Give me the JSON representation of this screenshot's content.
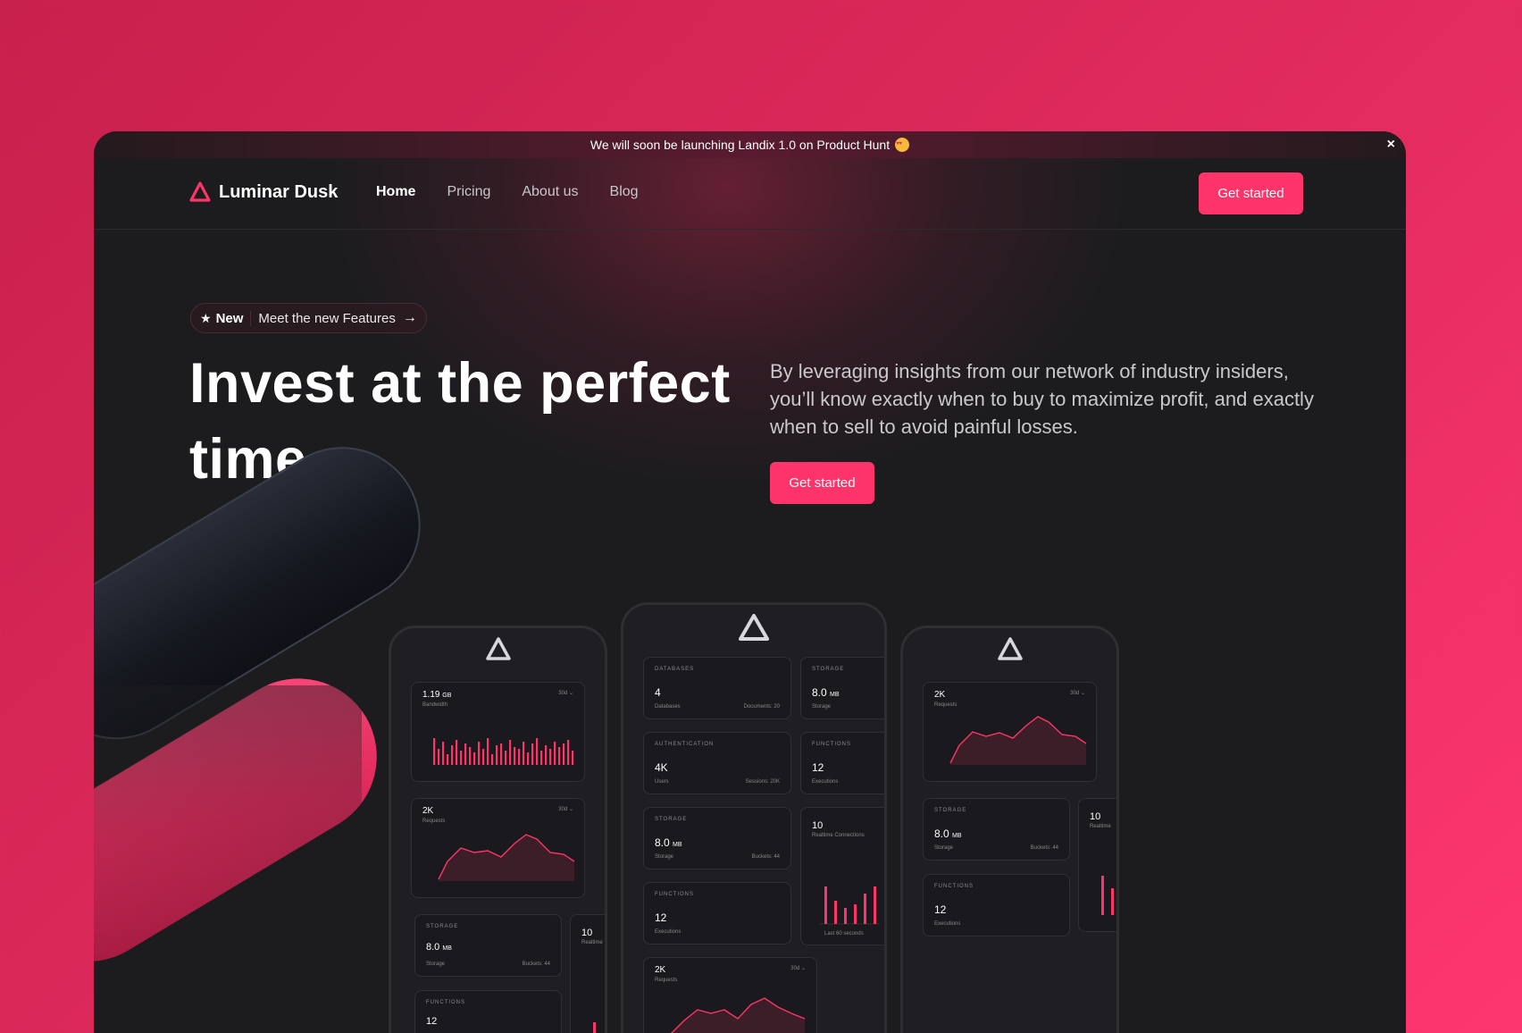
{
  "announcement": {
    "text": "We will soon be launching Landix 1.0 on Product Hunt",
    "emoji": "star-struck-emoji",
    "close": "×"
  },
  "brand": {
    "name": "Luminar Dusk",
    "icon": "triangle-logo-icon",
    "accent": "#ff3468"
  },
  "nav": {
    "links": [
      {
        "label": "Home",
        "active": true
      },
      {
        "label": "Pricing"
      },
      {
        "label": "About us"
      },
      {
        "label": "Blog"
      }
    ],
    "cta": "Get started"
  },
  "hero": {
    "badge_new": "New",
    "badge_text": "Meet the new Features",
    "headline": "Invest at the perfect time",
    "headline_dot": ".",
    "subcopy": "By leveraging insights from our network of industry insiders, you’ll know exactly when to buy to maximize profit, and exactly when to sell to avoid painful losses.",
    "cta": "Get started"
  },
  "phones": {
    "left": {
      "bandwidth": {
        "value": "1.19",
        "unit": "GB",
        "label": "Bandwidth",
        "range": "30d ⌄"
      },
      "requests": {
        "value": "2K",
        "label": "Requests",
        "range": "30d ⌄"
      },
      "storage": {
        "value": "8.0",
        "unit": "MB",
        "label": "Storage",
        "extra": "Buckets: 44",
        "title": "STORAGE"
      },
      "functions": {
        "value": "12",
        "title": "FUNCTIONS"
      },
      "realtime": {
        "value": "10",
        "label": "Realtime"
      }
    },
    "center": {
      "databases": {
        "title": "DATABASES",
        "value": "4",
        "label": "Databases",
        "extra": "Documents: 20"
      },
      "storage1": {
        "title": "STORAGE",
        "value": "8.0",
        "unit": "MB",
        "label": "Storage"
      },
      "auth": {
        "title": "AUTHENTICATION",
        "value": "4K",
        "label": "Users",
        "extra": "Sessions: 20K"
      },
      "functions1": {
        "title": "FUNCTIONS",
        "value": "12",
        "label": "Executions"
      },
      "storage2": {
        "title": "STORAGE",
        "value": "8.0",
        "unit": "MB",
        "label": "Storage",
        "extra": "Buckets: 44"
      },
      "realtime": {
        "value": "10",
        "label": "Realtime Connections",
        "foot": "Last 60 seconds"
      },
      "functions2": {
        "title": "FUNCTIONS",
        "value": "12",
        "label": "Executions"
      },
      "requests": {
        "value": "2K",
        "label": "Requests",
        "range": "30d ⌄"
      }
    },
    "right": {
      "requests": {
        "value": "2K",
        "label": "Requests",
        "range": "30d ⌄"
      },
      "storage": {
        "title": "STORAGE",
        "value": "8.0",
        "unit": "MB",
        "label": "Storage",
        "extra": "Buckets: 44"
      },
      "functions": {
        "title": "FUNCTIONS",
        "value": "12",
        "label": "Executions"
      },
      "realtime": {
        "value": "10",
        "label": "Realtime"
      }
    }
  }
}
